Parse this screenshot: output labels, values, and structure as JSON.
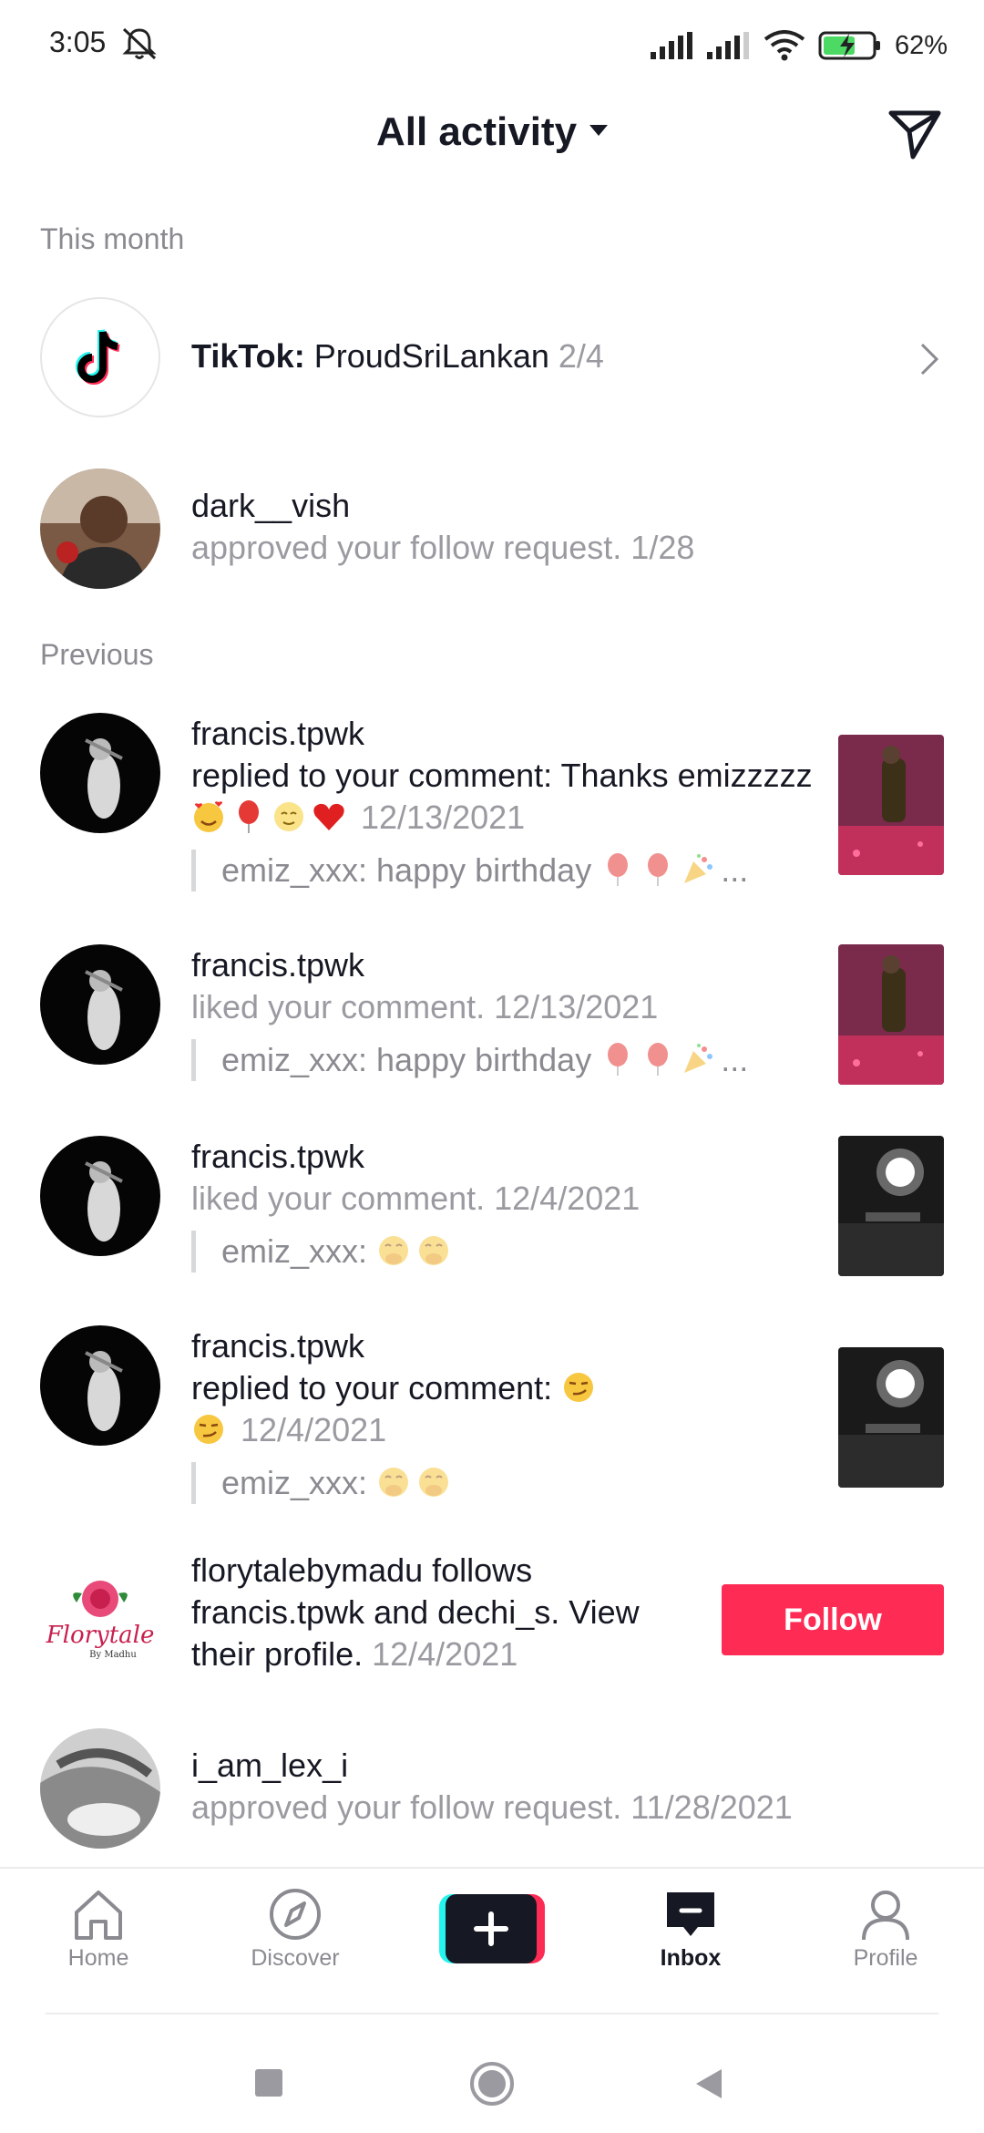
{
  "status_bar": {
    "time": "3:05",
    "battery": "62%"
  },
  "header": {
    "title": "All activity"
  },
  "sections": {
    "this_month": "This month",
    "previous": "Previous"
  },
  "system_notice": {
    "sender": "TikTok:",
    "message": "ProudSriLankan",
    "date": "2/4"
  },
  "approval_1": {
    "username": "dark__vish",
    "action": "approved your follow request.",
    "date": "1/28"
  },
  "activity": [
    {
      "username": "francis.tpwk",
      "action": "replied to your comment: Thanks emizzzzz",
      "date": "12/13/2021",
      "quote": "emiz_xxx: happy birthday"
    },
    {
      "username": "francis.tpwk",
      "action": "liked your comment.",
      "date": "12/13/2021",
      "quote": "emiz_xxx: happy birthday"
    },
    {
      "username": "francis.tpwk",
      "action": "liked your comment.",
      "date": "12/4/2021",
      "quote": "emiz_xxx:"
    },
    {
      "username": "francis.tpwk",
      "action": "replied to your comment:",
      "date": "12/4/2021",
      "quote": "emiz_xxx:"
    }
  ],
  "follow_suggestion": {
    "logo_text": "Florytale",
    "logo_sub": "By Madhu",
    "username": "florytalebymadu",
    "t1": " follows ",
    "user2": "francis.tpwk",
    "t2": " and ",
    "user3": "dechi_s",
    "t3": ". View their profile.",
    "date": "12/4/2021",
    "button": "Follow"
  },
  "approval_2": {
    "username": "i_am_lex_i",
    "action": "approved your follow request.",
    "date": "11/28/2021"
  },
  "bottom_nav": {
    "home": "Home",
    "discover": "Discover",
    "inbox": "Inbox",
    "profile": "Profile"
  },
  "colors": {
    "accent": "#fe2c55",
    "cyan": "#25f4ee",
    "text": "#161823",
    "muted": "#8a8b91"
  }
}
